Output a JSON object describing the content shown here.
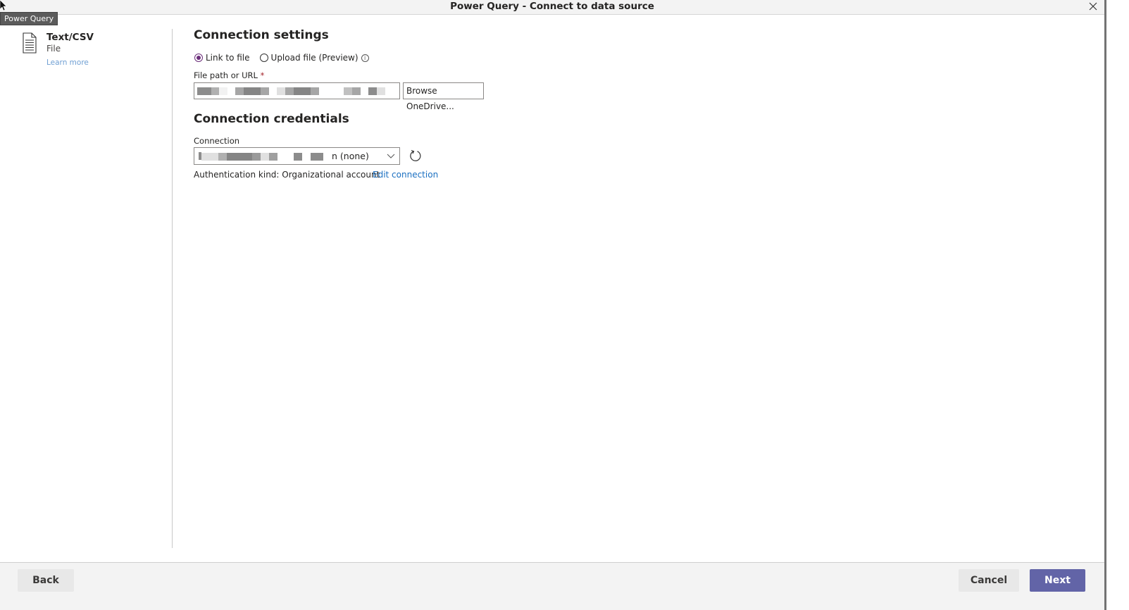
{
  "window": {
    "title": "Power Query - Connect to data source",
    "tooltip": "Power Query"
  },
  "connector": {
    "icon": "document-icon",
    "name": "Text/CSV",
    "kind": "File",
    "learn_more": "Learn more"
  },
  "settings": {
    "heading": "Connection settings",
    "radio_options": [
      {
        "label": "Link to file",
        "selected": true
      },
      {
        "label": "Upload file (Preview)",
        "selected": false
      }
    ],
    "info_icon": "i",
    "file_path_label": "File path or URL",
    "required_mark": "*",
    "file_path_value": "",
    "browse_label": "Browse OneDrive..."
  },
  "credentials": {
    "heading": "Connection credentials",
    "connection_label": "Connection",
    "connection_value_visible": "n (none)",
    "auth_text": "Authentication kind: Organizational account",
    "edit_link": "Edit connection"
  },
  "footer": {
    "back": "Back",
    "cancel": "Cancel",
    "next": "Next"
  },
  "colors": {
    "accent": "#6264a7",
    "radio_selected": "#6b2e7a",
    "link": "#1a6fc1",
    "required": "#a4262c"
  }
}
